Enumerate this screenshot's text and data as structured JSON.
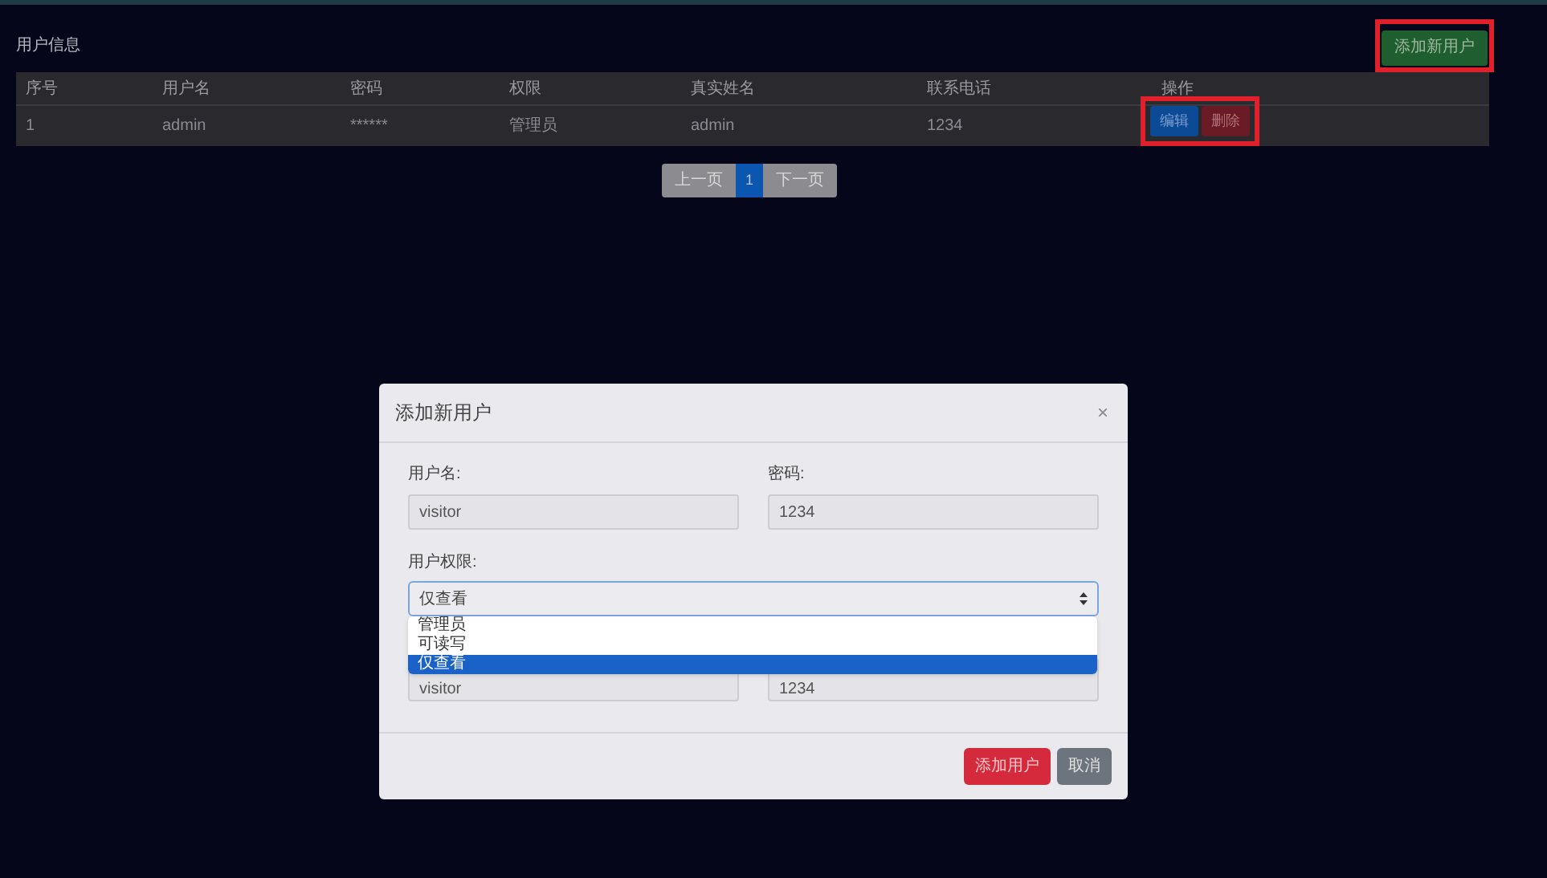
{
  "page": {
    "title": "用户信息",
    "add_button": "添加新用户"
  },
  "table": {
    "columns": [
      "序号",
      "用户名",
      "密码",
      "权限",
      "真实姓名",
      "联系电话",
      "操作"
    ],
    "rows": [
      {
        "cells": [
          "1",
          "admin",
          "******",
          "管理员",
          "admin",
          "1234"
        ],
        "actions": [
          {
            "kind": "edit",
            "label": "编辑"
          },
          {
            "kind": "delete",
            "label": "删除"
          }
        ]
      }
    ]
  },
  "pagination": {
    "prev": "上一页",
    "pages": [
      {
        "label": "1",
        "selected": true
      }
    ],
    "next": "下一页"
  },
  "modal": {
    "title": "添加新用户",
    "close": "×",
    "fields": [
      {
        "label": "用户名:",
        "value": "visitor"
      },
      {
        "label": "密码:",
        "value": "1234"
      }
    ],
    "select": {
      "label": "用户权限:",
      "value": "仅查看",
      "options": [
        {
          "label": "管理员",
          "selected": false
        },
        {
          "label": "可读写",
          "selected": false
        },
        {
          "label": "仅查看",
          "selected": true
        }
      ]
    },
    "hidden_fields": [
      {
        "value": "visitor"
      },
      {
        "value": "1234"
      }
    ],
    "buttons": [
      {
        "kind": "primary",
        "label": "添加用户"
      },
      {
        "kind": "secondary",
        "label": "取消"
      }
    ]
  }
}
